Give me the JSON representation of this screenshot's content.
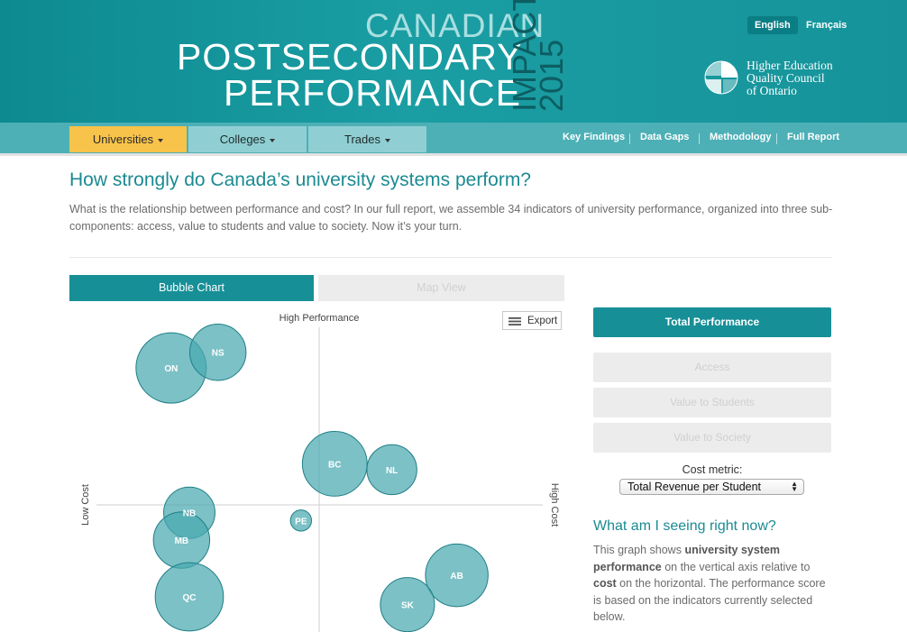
{
  "header": {
    "title_line1": "CANADIAN",
    "title_line2": "POSTSECONDARY",
    "title_line3": "PERFORMANCE",
    "vertical_word": "IMPACT",
    "vertical_year": "2015",
    "languages": [
      "English",
      "Français"
    ],
    "active_language": "English",
    "council_name": [
      "Higher Education",
      "Quality Council",
      "of Ontario"
    ]
  },
  "nav": {
    "tabs": [
      {
        "label": "Universities",
        "active": true
      },
      {
        "label": "Colleges",
        "active": false
      },
      {
        "label": "Trades",
        "active": false
      }
    ],
    "links": [
      "Key Findings",
      "Data Gaps",
      "Methodology",
      "Full Report"
    ]
  },
  "main": {
    "heading": "How strongly do Canada’s university systems perform?",
    "intro": "What is the relationship between performance and cost? In our full report, we assemble 34 indicators of university performance, organized into three sub-components: access, value to students and value to society. Now it’s your turn."
  },
  "view_tabs": [
    {
      "label": "Bubble Chart",
      "active": true
    },
    {
      "label": "Map View",
      "active": false
    }
  ],
  "export_label": "Export",
  "chart_data": {
    "type": "scatter",
    "title": "",
    "ylabel_top": "High Performance",
    "xlabel_left": "Low Cost",
    "xlabel_right": "High Cost",
    "bubble_color": "#4aa9b0",
    "xlim": [
      -1,
      1
    ],
    "ylim": [
      -1,
      1
    ],
    "points": [
      {
        "label": "ON",
        "x": -0.57,
        "y": 0.7,
        "size": 1.0
      },
      {
        "label": "NS",
        "x": -0.39,
        "y": 0.78,
        "size": 0.8
      },
      {
        "label": "BC",
        "x": 0.06,
        "y": 0.21,
        "size": 0.92
      },
      {
        "label": "NL",
        "x": 0.28,
        "y": 0.18,
        "size": 0.71
      },
      {
        "label": "PE",
        "x": -0.07,
        "y": -0.08,
        "size": 0.3
      },
      {
        "label": "NB",
        "x": -0.5,
        "y": -0.04,
        "size": 0.73
      },
      {
        "label": "MB",
        "x": -0.53,
        "y": -0.18,
        "size": 0.8
      },
      {
        "label": "QC",
        "x": -0.5,
        "y": -0.47,
        "size": 0.97
      },
      {
        "label": "AB",
        "x": 0.53,
        "y": -0.36,
        "size": 0.89
      },
      {
        "label": "SK",
        "x": 0.34,
        "y": -0.51,
        "size": 0.77
      }
    ]
  },
  "sidebar": {
    "buttons": [
      {
        "label": "Total Performance",
        "active": true
      },
      {
        "label": "Access",
        "active": false
      },
      {
        "label": "Value to Students",
        "active": false
      },
      {
        "label": "Value to Society",
        "active": false
      }
    ],
    "cost_metric_label": "Cost metric:",
    "cost_metric_value": "Total Revenue per Student",
    "seeing_title": "What am I seeing right now?",
    "seeing_parts": [
      "This graph shows ",
      "university system performance",
      " on the vertical axis relative to ",
      "cost",
      " on the horizontal. The performance score is based on the indicators currently selected below."
    ]
  }
}
